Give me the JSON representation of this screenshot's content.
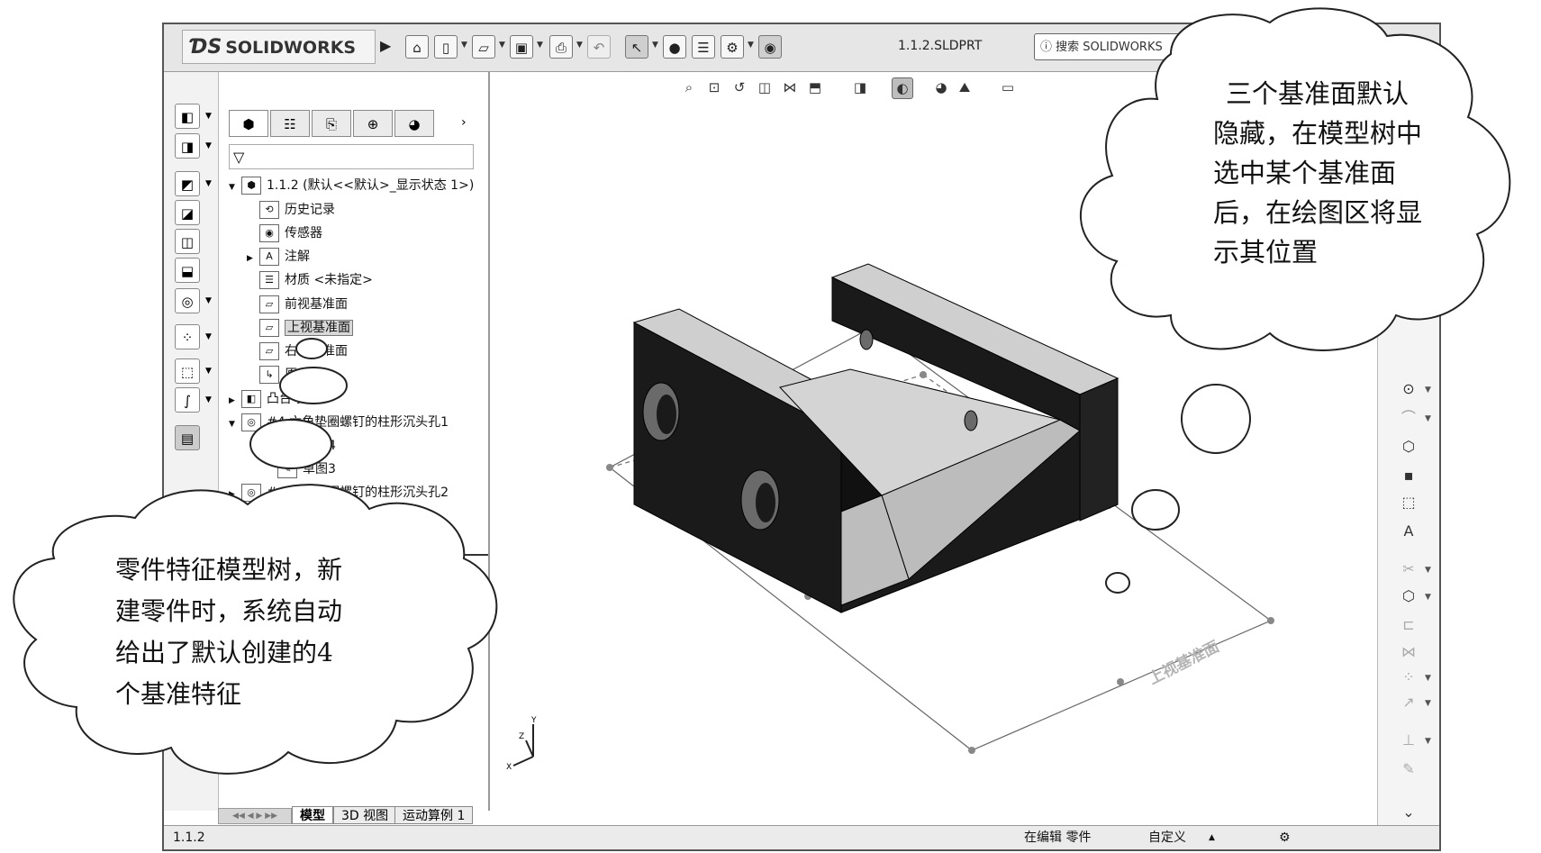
{
  "app": {
    "brand": "SOLIDWORKS",
    "filename": "1.1.2.SLDPRT",
    "search_label": "搜索 SOLIDWORKS"
  },
  "feature_tree": {
    "root": "1.1.2  (默认<<默认>_显示状态 1>)",
    "items": [
      {
        "label": "历史记录",
        "icon": "history-icon"
      },
      {
        "label": "传感器",
        "icon": "sensor-icon"
      },
      {
        "label": "注解",
        "icon": "annotation-icon"
      },
      {
        "label": "材质 <未指定>",
        "icon": "material-icon"
      },
      {
        "label": "前视基准面",
        "icon": "plane-icon"
      },
      {
        "label": "上视基准面",
        "icon": "plane-icon"
      },
      {
        "label": "右视基准面",
        "icon": "plane-icon"
      },
      {
        "label": "原点",
        "icon": "origin-icon"
      },
      {
        "label": "凸台-拉伸1",
        "icon": "extrude-icon"
      },
      {
        "label": "#4 六角垫圈螺钉的柱形沉头孔1",
        "icon": "hole-icon"
      },
      {
        "label": "草图4",
        "icon": "sketch-icon"
      },
      {
        "label": "草图3",
        "icon": "sketch-icon"
      },
      {
        "label": "#4 六角垫圈螺钉的柱形沉头孔2",
        "icon": "hole-icon"
      }
    ]
  },
  "bottom_tabs": [
    "模型",
    "3D 视图",
    "运动算例 1"
  ],
  "status": {
    "left": "1.1.2",
    "editing": "在编辑 零件",
    "units": "自定义"
  },
  "viewport": {
    "plane_label": "上视基准面",
    "triad": {
      "x": "X",
      "y": "Y",
      "z": "Z"
    }
  },
  "callouts": {
    "top_right": [
      "三个基准面默认",
      "隐藏，在模型树中",
      "选中某个基准面",
      "后，在绘图区将显",
      "示其位置"
    ],
    "bottom_left": [
      "零件特征模型树，新",
      "建零件时，系统自动",
      "给出了默认创建的4",
      "个基准特征"
    ]
  },
  "colors": {
    "part_dark": "#1a1a1a",
    "part_face": "#c8c8c8",
    "selection": "#d8d8d8"
  }
}
